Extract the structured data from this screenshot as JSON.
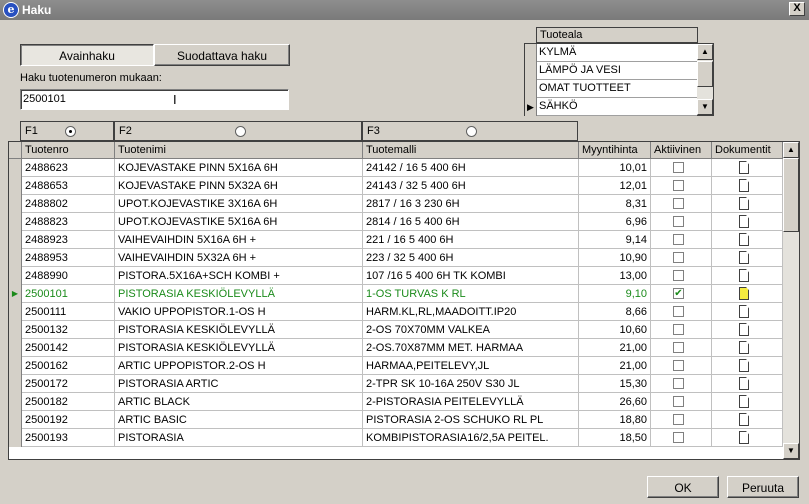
{
  "window": {
    "title": "Haku",
    "close_glyph": "X",
    "app_icon_glyph": "e"
  },
  "tabs": [
    {
      "label": "Avainhaku",
      "active": true
    },
    {
      "label": "Suodattava haku",
      "active": false
    }
  ],
  "search": {
    "label": "Haku tuotenumeron mukaan:",
    "value": "2500101"
  },
  "tuoteala": {
    "header": "Tuoteala",
    "items": [
      "KYLMÄ",
      "LÄMPÖ JA VESI",
      "OMAT TUOTTEET",
      "SÄHKÖ"
    ],
    "selected_index": 3
  },
  "filters": [
    {
      "label": "F1",
      "selected": true
    },
    {
      "label": "F2",
      "selected": false
    },
    {
      "label": "F3",
      "selected": false
    }
  ],
  "grid": {
    "columns": [
      "Tuotenro",
      "Tuotenimi",
      "Tuotemalli",
      "Myyntihinta",
      "Aktiivinen",
      "Dokumentit"
    ],
    "rows": [
      {
        "nro": "2488623",
        "nimi": "KOJEVASTAKE PINN 5X16A 6H",
        "malli": "24142 / 16 5 400 6H",
        "hinta": "10,01",
        "aktiivinen": false,
        "doc": "white"
      },
      {
        "nro": "2488653",
        "nimi": "KOJEVASTAKE PINN 5X32A 6H",
        "malli": "24143 / 32 5 400 6H",
        "hinta": "12,01",
        "aktiivinen": false,
        "doc": "white"
      },
      {
        "nro": "2488802",
        "nimi": "UPOT.KOJEVASTIKE 3X16A 6H",
        "malli": "2817 / 16 3 230 6H",
        "hinta": "8,31",
        "aktiivinen": false,
        "doc": "white"
      },
      {
        "nro": "2488823",
        "nimi": "UPOT.KOJEVASTIKE 5X16A 6H",
        "malli": "2814 / 16 5 400 6H",
        "hinta": "6,96",
        "aktiivinen": false,
        "doc": "white"
      },
      {
        "nro": "2488923",
        "nimi": "VAIHEVAIHDIN 5X16A 6H +",
        "malli": "221 / 16 5 400 6H",
        "hinta": "9,14",
        "aktiivinen": false,
        "doc": "white"
      },
      {
        "nro": "2488953",
        "nimi": "VAIHEVAIHDIN 5X32A 6H +",
        "malli": "223 / 32 5 400 6H",
        "hinta": "10,90",
        "aktiivinen": false,
        "doc": "white"
      },
      {
        "nro": "2488990",
        "nimi": "PISTORA.5X16A+SCH KOMBI +",
        "malli": "107 /16 5 400 6H TK KOMBI",
        "hinta": "13,00",
        "aktiivinen": false,
        "doc": "white"
      },
      {
        "nro": "2500101",
        "nimi": "PISTORASIA KESKIÖLEVYLLÄ",
        "malli": "1-OS TURVAS K RL",
        "hinta": "9,10",
        "aktiivinen": true,
        "doc": "yellow",
        "current": true
      },
      {
        "nro": "2500111",
        "nimi": "VAKIO UPPOPISTOR.1-OS H",
        "malli": "HARM.KL,RL,MAADOITT.IP20",
        "hinta": "8,66",
        "aktiivinen": false,
        "doc": "white"
      },
      {
        "nro": "2500132",
        "nimi": "PISTORASIA KESKIÖLEVYLLÄ",
        "malli": "2-OS 70X70MM VALKEA",
        "hinta": "10,60",
        "aktiivinen": false,
        "doc": "white"
      },
      {
        "nro": "2500142",
        "nimi": "PISTORASIA KESKIÖLEVYLLÄ",
        "malli": "2-OS.70X87MM MET. HARMAA",
        "hinta": "21,00",
        "aktiivinen": false,
        "doc": "white"
      },
      {
        "nro": "2500162",
        "nimi": "ARTIC UPPOPISTOR.2-OS H",
        "malli": "HARMAA,PEITELEVY,JL",
        "hinta": "21,00",
        "aktiivinen": false,
        "doc": "white"
      },
      {
        "nro": "2500172",
        "nimi": "PISTORASIA ARTIC",
        "malli": "2-TPR SK 10-16A 250V S30 JL",
        "hinta": "15,30",
        "aktiivinen": false,
        "doc": "white"
      },
      {
        "nro": "2500182",
        "nimi": "ARTIC BLACK",
        "malli": "2-PISTORASIA PEITELEVYLLÄ",
        "hinta": "26,60",
        "aktiivinen": false,
        "doc": "white"
      },
      {
        "nro": "2500192",
        "nimi": "ARTIC BASIC",
        "malli": "PISTORASIA 2-OS SCHUKO RL PL",
        "hinta": "18,80",
        "aktiivinen": false,
        "doc": "white"
      },
      {
        "nro": "2500193",
        "nimi": "PISTORASIA",
        "malli": "KOMBIPISTORASIA16/2,5A PEITEL.",
        "hinta": "18,50",
        "aktiivinen": false,
        "doc": "white"
      }
    ]
  },
  "buttons": {
    "ok": "OK",
    "cancel": "Peruuta"
  },
  "colors": {
    "current_row_text": "#1a8a1a",
    "title_bar": "#808080"
  }
}
